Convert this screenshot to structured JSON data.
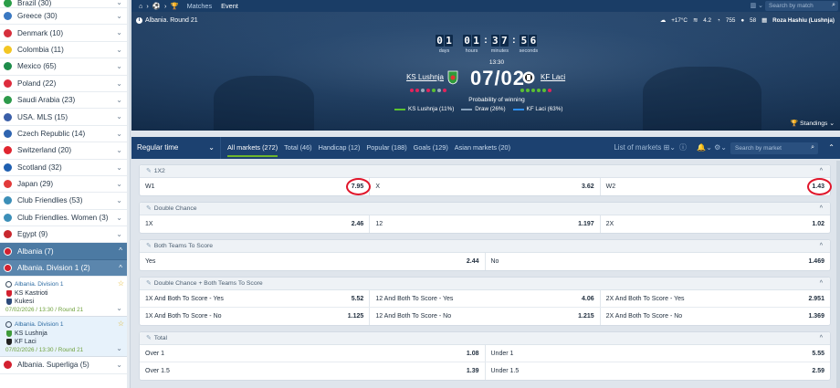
{
  "sidebar": {
    "countries": [
      {
        "label": "Brazil (30)",
        "flag": "#2a9d48"
      },
      {
        "label": "Greece (30)",
        "flag": "#3a78c2"
      },
      {
        "label": "Denmark (10)",
        "flag": "#d62f3c"
      },
      {
        "label": "Colombia (11)",
        "flag": "#f3c623"
      },
      {
        "label": "Mexico (65)",
        "flag": "#1d8c4a"
      },
      {
        "label": "Poland (22)",
        "flag": "#dd2c3d"
      },
      {
        "label": "Saudi Arabia (23)",
        "flag": "#2d9a4b"
      },
      {
        "label": "USA. MLS (15)",
        "flag": "#3a5ea8"
      },
      {
        "label": "Czech Republic (14)",
        "flag": "#2e64b0"
      },
      {
        "label": "Switzerland (20)",
        "flag": "#e0252f"
      },
      {
        "label": "Scotland (32)",
        "flag": "#1f5fb0"
      },
      {
        "label": "Japan (29)",
        "flag": "#e23a3a"
      },
      {
        "label": "Club Friendlies (53)",
        "flag": "#3c8fb8"
      },
      {
        "label": "Club Friendlies. Women (3)",
        "flag": "#3c8fb8"
      },
      {
        "label": "Egypt (9)",
        "flag": "#c8272e"
      }
    ],
    "albania": {
      "label": "Albania (7)",
      "flag": "#d3202f"
    },
    "albania_div1": {
      "label": "Albania. Division 1 (2)",
      "flag": "#d3202f"
    },
    "matches": [
      {
        "league": "Albania. Division 1",
        "home": "KS Kastrioti",
        "away": "Kukesi",
        "date": "07/02/2026 / 13:30 / Round 21"
      },
      {
        "league": "Albania. Division 1",
        "home": "KS Lushnja",
        "away": "KF Laci",
        "date": "07/02/2026 / 13:30 / Round 21"
      }
    ],
    "superliga": {
      "label": "Albania. Superliga (5)",
      "flag": "#d3202f"
    }
  },
  "topbar": {
    "crumb": "⌂ › ⚽ › 🏆",
    "tabs": [
      "Matches",
      "Event"
    ],
    "search_placeholder": "Search by match"
  },
  "hero": {
    "round": "Albania. Round 21",
    "weather": {
      "temp": "+17°C",
      "wind": "4.2",
      "pressure": "755",
      "humidity": "58",
      "venue": "Roza Hashiu (Lushnja)"
    },
    "timer": {
      "days": "0 1",
      "hours": "0 1",
      "minutes": "3 7",
      "seconds": "5 6"
    },
    "timer_labels": {
      "days": "days",
      "hours": "hours",
      "minutes": "minutes",
      "seconds": "seconds"
    },
    "start_time": "13:30",
    "home": "KS Lushnja",
    "away": "KF Laci",
    "score": "07/02",
    "probability_title": "Probability of winning",
    "legend": [
      {
        "label": "KS Lushnja (11%)",
        "color": "#5cc330"
      },
      {
        "label": "Draw (26%)",
        "color": "#8aa3bd"
      },
      {
        "label": "KF Laci (63%)",
        "color": "#2e8ef0"
      }
    ],
    "standings": "Standings"
  },
  "market_bar": {
    "period": "Regular time",
    "tabs": [
      "All markets (272)",
      "Total (46)",
      "Handicap (12)",
      "Popular (188)",
      "Goals (129)",
      "Asian markets (20)"
    ],
    "list_label": "List of markets",
    "search_placeholder": "Search by market"
  },
  "markets": [
    {
      "title": "1X2",
      "rows": [
        [
          {
            "l": "W1",
            "o": "7.95"
          },
          {
            "l": "X",
            "o": "3.62"
          },
          {
            "l": "W2",
            "o": "1.43"
          }
        ]
      ]
    },
    {
      "title": "Double Chance",
      "rows": [
        [
          {
            "l": "1X",
            "o": "2.46"
          },
          {
            "l": "12",
            "o": "1.197"
          },
          {
            "l": "2X",
            "o": "1.02"
          }
        ]
      ]
    },
    {
      "title": "Both Teams To Score",
      "rows": [
        [
          {
            "l": "Yes",
            "o": "2.44"
          },
          {
            "l": "No",
            "o": "1.469"
          }
        ]
      ]
    },
    {
      "title": "Double Chance + Both Teams To Score",
      "rows": [
        [
          {
            "l": "1X And Both To Score - Yes",
            "o": "5.52"
          },
          {
            "l": "12 And Both To Score - Yes",
            "o": "4.06"
          },
          {
            "l": "2X And Both To Score - Yes",
            "o": "2.951"
          }
        ],
        [
          {
            "l": "1X And Both To Score - No",
            "o": "1.125"
          },
          {
            "l": "12 And Both To Score - No",
            "o": "1.215"
          },
          {
            "l": "2X And Both To Score - No",
            "o": "1.369"
          }
        ]
      ]
    },
    {
      "title": "Total",
      "rows": [
        [
          {
            "l": "Over 1",
            "o": "1.08"
          },
          {
            "l": "Under 1",
            "o": "5.55"
          }
        ],
        [
          {
            "l": "Over 1.5",
            "o": "1.39"
          },
          {
            "l": "Under 1.5",
            "o": "2.59"
          }
        ]
      ]
    }
  ]
}
